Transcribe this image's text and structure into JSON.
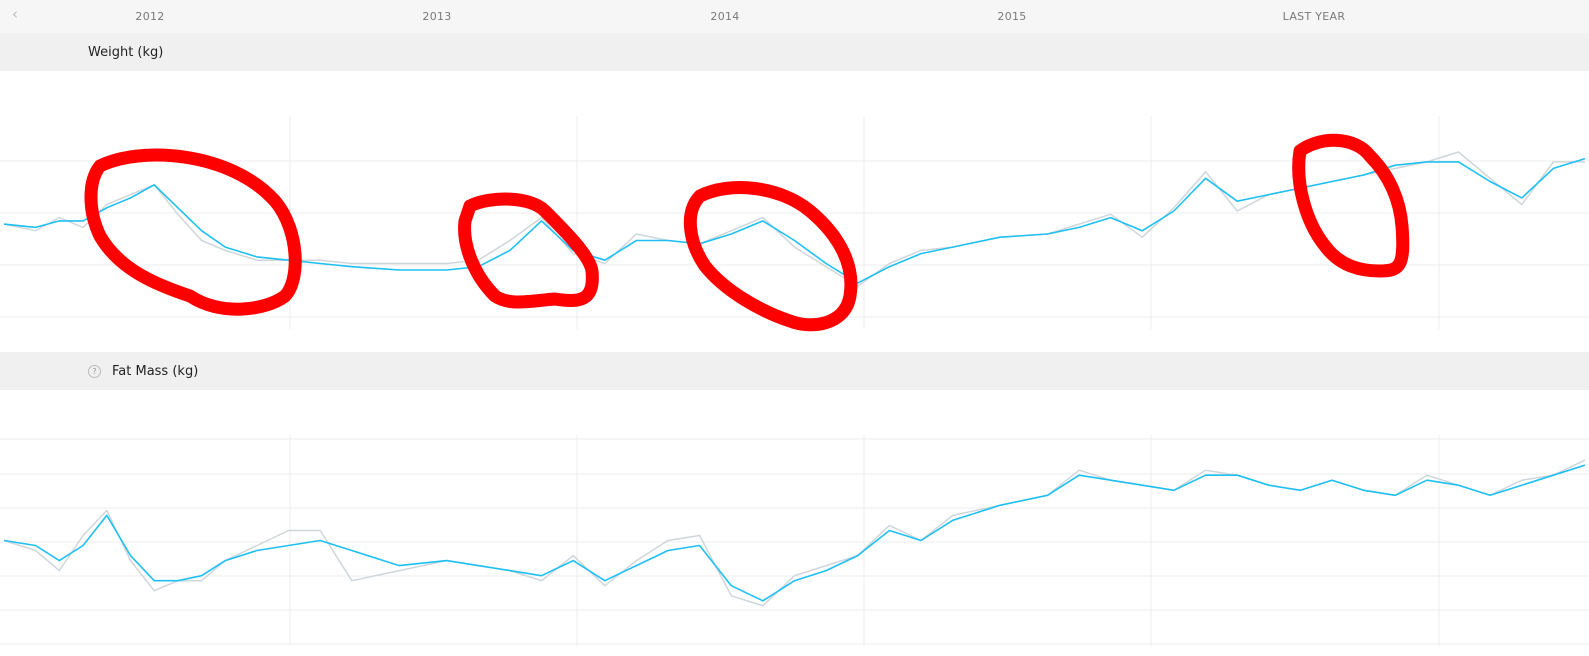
{
  "timeline": {
    "prev_icon": "chevron-left-icon",
    "ticks": [
      "2012",
      "2013",
      "2014",
      "2015",
      "LAST YEAR"
    ]
  },
  "colors": {
    "trend": "#1ec0f2",
    "raw": "#cfd6da",
    "annotation": "#ff0000",
    "grid": "#ececec"
  },
  "chart_data": [
    {
      "type": "line",
      "title": "Weight (kg)",
      "x": [
        0,
        0.02,
        0.035,
        0.05,
        0.065,
        0.08,
        0.095,
        0.11,
        0.125,
        0.14,
        0.16,
        0.18,
        0.2,
        0.22,
        0.25,
        0.28,
        0.3,
        0.32,
        0.34,
        0.36,
        0.38,
        0.4,
        0.42,
        0.44,
        0.46,
        0.48,
        0.5,
        0.52,
        0.54,
        0.56,
        0.58,
        0.6,
        0.63,
        0.66,
        0.68,
        0.7,
        0.72,
        0.74,
        0.76,
        0.78,
        0.8,
        0.82,
        0.84,
        0.86,
        0.88,
        0.9,
        0.92,
        0.94,
        0.96,
        0.98,
        1.0
      ],
      "series": [
        {
          "values": [
            68.7,
            68.5,
            68.9,
            68.6,
            69.3,
            69.6,
            69.9,
            69.0,
            68.2,
            67.9,
            67.6,
            67.6,
            67.6,
            67.5,
            67.5,
            67.5,
            67.6,
            68.2,
            68.9,
            67.8,
            67.5,
            68.4,
            68.2,
            68.1,
            68.5,
            68.9,
            68.0,
            67.4,
            66.8,
            67.5,
            67.9,
            68.0,
            68.3,
            68.4,
            68.7,
            69.0,
            68.3,
            69.2,
            70.3,
            69.1,
            69.6,
            69.8,
            70.0,
            70.2,
            70.4,
            70.6,
            70.9,
            70.1,
            69.3,
            70.6,
            70.6
          ]
        },
        {
          "values": [
            68.7,
            68.6,
            68.8,
            68.8,
            69.2,
            69.5,
            69.9,
            69.2,
            68.5,
            68.0,
            67.7,
            67.6,
            67.5,
            67.4,
            67.3,
            67.3,
            67.4,
            67.9,
            68.8,
            67.9,
            67.6,
            68.2,
            68.2,
            68.1,
            68.4,
            68.8,
            68.2,
            67.5,
            66.9,
            67.4,
            67.8,
            68.0,
            68.3,
            68.4,
            68.6,
            68.9,
            68.5,
            69.1,
            70.1,
            69.4,
            69.6,
            69.8,
            70.0,
            70.2,
            70.5,
            70.6,
            70.6,
            70.0,
            69.5,
            70.4,
            70.7
          ]
        }
      ]
    },
    {
      "type": "line",
      "title": "Fat Mass (kg)",
      "x": [
        0,
        0.02,
        0.035,
        0.05,
        0.065,
        0.08,
        0.095,
        0.11,
        0.125,
        0.14,
        0.16,
        0.18,
        0.2,
        0.22,
        0.25,
        0.28,
        0.3,
        0.32,
        0.34,
        0.36,
        0.38,
        0.4,
        0.42,
        0.44,
        0.46,
        0.48,
        0.5,
        0.52,
        0.54,
        0.56,
        0.58,
        0.6,
        0.63,
        0.66,
        0.68,
        0.7,
        0.72,
        0.74,
        0.76,
        0.78,
        0.8,
        0.82,
        0.84,
        0.86,
        0.88,
        0.9,
        0.92,
        0.94,
        0.96,
        0.98,
        1.0
      ],
      "series": [
        {
          "values": [
            13.1,
            12.9,
            12.5,
            13.2,
            13.7,
            12.7,
            12.1,
            12.3,
            12.3,
            12.7,
            13.0,
            13.3,
            13.3,
            12.3,
            12.5,
            12.7,
            12.6,
            12.5,
            12.3,
            12.8,
            12.2,
            12.7,
            13.1,
            13.2,
            12.0,
            11.8,
            12.4,
            12.6,
            12.8,
            13.4,
            13.1,
            13.6,
            13.8,
            14.0,
            14.5,
            14.3,
            14.2,
            14.1,
            14.5,
            14.4,
            14.2,
            14.1,
            14.3,
            14.1,
            14.0,
            14.4,
            14.2,
            14.0,
            14.3,
            14.4,
            14.7
          ]
        },
        {
          "values": [
            13.1,
            13.0,
            12.7,
            13.0,
            13.6,
            12.8,
            12.3,
            12.3,
            12.4,
            12.7,
            12.9,
            13.0,
            13.1,
            12.9,
            12.6,
            12.7,
            12.6,
            12.5,
            12.4,
            12.7,
            12.3,
            12.6,
            12.9,
            13.0,
            12.2,
            11.9,
            12.3,
            12.5,
            12.8,
            13.3,
            13.1,
            13.5,
            13.8,
            14.0,
            14.4,
            14.3,
            14.2,
            14.1,
            14.4,
            14.4,
            14.2,
            14.1,
            14.3,
            14.1,
            14.0,
            14.3,
            14.2,
            14.0,
            14.2,
            14.4,
            14.6
          ]
        }
      ]
    }
  ]
}
